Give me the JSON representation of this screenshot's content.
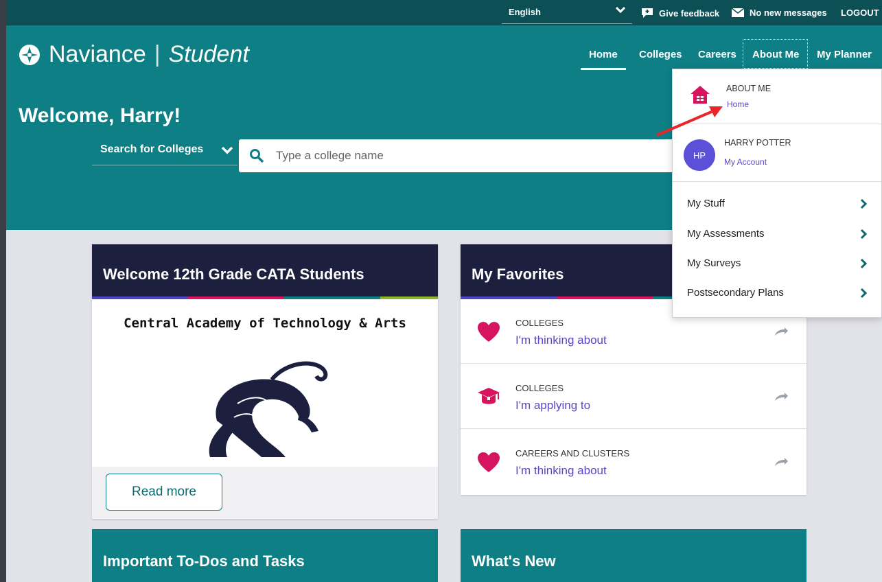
{
  "utility_bar": {
    "language": "English",
    "feedback": "Give feedback",
    "messages": "No new messages",
    "logout": "LOGOUT"
  },
  "brand": {
    "name": "Naviance",
    "product": "Student"
  },
  "nav": [
    "Home",
    "Colleges",
    "Careers",
    "About Me",
    "My Planner"
  ],
  "hero": {
    "welcome": "Welcome, Harry!",
    "search_mode": "Search for Colleges",
    "search_placeholder": "Type a college name"
  },
  "welcome_card": {
    "title": "Welcome 12th Grade CATA Students",
    "school_name": "Central Academy of Technology & Arts",
    "button": "Read more"
  },
  "favorites": {
    "title": "My Favorites",
    "items": [
      {
        "category": "COLLEGES",
        "link": "I'm thinking about",
        "icon": "heart-icon"
      },
      {
        "category": "COLLEGES",
        "link": "I'm applying to",
        "icon": "graduation-cap-icon"
      },
      {
        "category": "CAREERS AND CLUSTERS",
        "link": "I'm thinking about",
        "icon": "heart-icon"
      }
    ]
  },
  "bottom_cards": [
    "Important To-Dos and Tasks",
    "What's New"
  ],
  "dropdown": {
    "about_label": "ABOUT ME",
    "about_link": "Home",
    "user_initials": "HP",
    "user_name": "HARRY POTTER",
    "account_link": "My Account",
    "items": [
      "My Stuff",
      "My Assessments",
      "My Surveys",
      "Postsecondary Plans"
    ]
  },
  "colors": {
    "teal": "#0d7f85",
    "dark_teal": "#0c4f55",
    "navy": "#1d1f3e",
    "magenta": "#d6145f",
    "purple": "#5a46c8",
    "annotation_red": "#e8262a"
  }
}
